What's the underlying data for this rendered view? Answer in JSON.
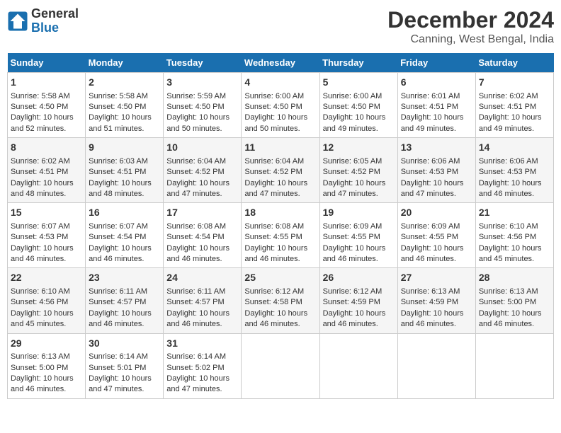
{
  "logo": {
    "line1": "General",
    "line2": "Blue"
  },
  "title": "December 2024",
  "subtitle": "Canning, West Bengal, India",
  "days_header": [
    "Sunday",
    "Monday",
    "Tuesday",
    "Wednesday",
    "Thursday",
    "Friday",
    "Saturday"
  ],
  "weeks": [
    [
      {
        "day": "1",
        "info": "Sunrise: 5:58 AM\nSunset: 4:50 PM\nDaylight: 10 hours\nand 52 minutes."
      },
      {
        "day": "2",
        "info": "Sunrise: 5:58 AM\nSunset: 4:50 PM\nDaylight: 10 hours\nand 51 minutes."
      },
      {
        "day": "3",
        "info": "Sunrise: 5:59 AM\nSunset: 4:50 PM\nDaylight: 10 hours\nand 50 minutes."
      },
      {
        "day": "4",
        "info": "Sunrise: 6:00 AM\nSunset: 4:50 PM\nDaylight: 10 hours\nand 50 minutes."
      },
      {
        "day": "5",
        "info": "Sunrise: 6:00 AM\nSunset: 4:50 PM\nDaylight: 10 hours\nand 49 minutes."
      },
      {
        "day": "6",
        "info": "Sunrise: 6:01 AM\nSunset: 4:51 PM\nDaylight: 10 hours\nand 49 minutes."
      },
      {
        "day": "7",
        "info": "Sunrise: 6:02 AM\nSunset: 4:51 PM\nDaylight: 10 hours\nand 49 minutes."
      }
    ],
    [
      {
        "day": "8",
        "info": "Sunrise: 6:02 AM\nSunset: 4:51 PM\nDaylight: 10 hours\nand 48 minutes."
      },
      {
        "day": "9",
        "info": "Sunrise: 6:03 AM\nSunset: 4:51 PM\nDaylight: 10 hours\nand 48 minutes."
      },
      {
        "day": "10",
        "info": "Sunrise: 6:04 AM\nSunset: 4:52 PM\nDaylight: 10 hours\nand 47 minutes."
      },
      {
        "day": "11",
        "info": "Sunrise: 6:04 AM\nSunset: 4:52 PM\nDaylight: 10 hours\nand 47 minutes."
      },
      {
        "day": "12",
        "info": "Sunrise: 6:05 AM\nSunset: 4:52 PM\nDaylight: 10 hours\nand 47 minutes."
      },
      {
        "day": "13",
        "info": "Sunrise: 6:06 AM\nSunset: 4:53 PM\nDaylight: 10 hours\nand 47 minutes."
      },
      {
        "day": "14",
        "info": "Sunrise: 6:06 AM\nSunset: 4:53 PM\nDaylight: 10 hours\nand 46 minutes."
      }
    ],
    [
      {
        "day": "15",
        "info": "Sunrise: 6:07 AM\nSunset: 4:53 PM\nDaylight: 10 hours\nand 46 minutes."
      },
      {
        "day": "16",
        "info": "Sunrise: 6:07 AM\nSunset: 4:54 PM\nDaylight: 10 hours\nand 46 minutes."
      },
      {
        "day": "17",
        "info": "Sunrise: 6:08 AM\nSunset: 4:54 PM\nDaylight: 10 hours\nand 46 minutes."
      },
      {
        "day": "18",
        "info": "Sunrise: 6:08 AM\nSunset: 4:55 PM\nDaylight: 10 hours\nand 46 minutes."
      },
      {
        "day": "19",
        "info": "Sunrise: 6:09 AM\nSunset: 4:55 PM\nDaylight: 10 hours\nand 46 minutes."
      },
      {
        "day": "20",
        "info": "Sunrise: 6:09 AM\nSunset: 4:55 PM\nDaylight: 10 hours\nand 46 minutes."
      },
      {
        "day": "21",
        "info": "Sunrise: 6:10 AM\nSunset: 4:56 PM\nDaylight: 10 hours\nand 45 minutes."
      }
    ],
    [
      {
        "day": "22",
        "info": "Sunrise: 6:10 AM\nSunset: 4:56 PM\nDaylight: 10 hours\nand 45 minutes."
      },
      {
        "day": "23",
        "info": "Sunrise: 6:11 AM\nSunset: 4:57 PM\nDaylight: 10 hours\nand 46 minutes."
      },
      {
        "day": "24",
        "info": "Sunrise: 6:11 AM\nSunset: 4:57 PM\nDaylight: 10 hours\nand 46 minutes."
      },
      {
        "day": "25",
        "info": "Sunrise: 6:12 AM\nSunset: 4:58 PM\nDaylight: 10 hours\nand 46 minutes."
      },
      {
        "day": "26",
        "info": "Sunrise: 6:12 AM\nSunset: 4:59 PM\nDaylight: 10 hours\nand 46 minutes."
      },
      {
        "day": "27",
        "info": "Sunrise: 6:13 AM\nSunset: 4:59 PM\nDaylight: 10 hours\nand 46 minutes."
      },
      {
        "day": "28",
        "info": "Sunrise: 6:13 AM\nSunset: 5:00 PM\nDaylight: 10 hours\nand 46 minutes."
      }
    ],
    [
      {
        "day": "29",
        "info": "Sunrise: 6:13 AM\nSunset: 5:00 PM\nDaylight: 10 hours\nand 46 minutes."
      },
      {
        "day": "30",
        "info": "Sunrise: 6:14 AM\nSunset: 5:01 PM\nDaylight: 10 hours\nand 47 minutes."
      },
      {
        "day": "31",
        "info": "Sunrise: 6:14 AM\nSunset: 5:02 PM\nDaylight: 10 hours\nand 47 minutes."
      },
      {
        "day": "",
        "info": ""
      },
      {
        "day": "",
        "info": ""
      },
      {
        "day": "",
        "info": ""
      },
      {
        "day": "",
        "info": ""
      }
    ]
  ]
}
